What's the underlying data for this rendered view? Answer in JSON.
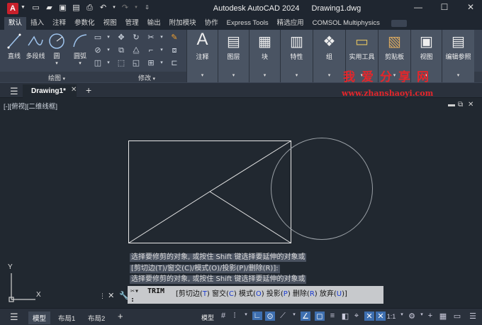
{
  "window": {
    "app_letter": "A",
    "title_app": "Autodesk AutoCAD 2024",
    "title_file": "Drawing1.dwg",
    "minimize": "—",
    "maximize": "☐",
    "close": "✕"
  },
  "ribbon_tabs": [
    "默认",
    "插入",
    "注释",
    "参数化",
    "视图",
    "管理",
    "输出",
    "附加模块",
    "协作",
    "Express Tools",
    "精选应用",
    "COMSOL Multiphysics"
  ],
  "draw_panel": {
    "tools": [
      "直线",
      "多段线",
      "圆",
      "圆弧"
    ],
    "title": "绘图"
  },
  "modify_panel": {
    "title": "修改"
  },
  "big_panels": [
    {
      "label": "注释",
      "glyph": "A"
    },
    {
      "label": "图层",
      "glyph": "▤"
    },
    {
      "label": "块",
      "glyph": "▦"
    },
    {
      "label": "特性",
      "glyph": "▥"
    },
    {
      "label": "组",
      "glyph": "❖"
    },
    {
      "label": "实用工具",
      "glyph": "▭"
    },
    {
      "label": "剪贴板",
      "glyph": "▧"
    },
    {
      "label": "视图",
      "glyph": "▣"
    },
    {
      "label": "编辑参照",
      "glyph": "▤"
    }
  ],
  "file_tab": {
    "name": "Drawing1*",
    "close": "✕",
    "new": "+"
  },
  "watermark": {
    "cn": "我爱分享网",
    "url": "www.zhanshaoyi.com"
  },
  "viewport": {
    "label": "[-][俯视][二维线框]"
  },
  "command": {
    "history": [
      "选择要修剪的对象, 或按住 Shift 键选择要延伸的对象或",
      "[剪切边(T)/窗交(C)/模式(O)/投影(P)/删除(R)]:",
      "选择要修剪的对象, 或按住 Shift 键选择要延伸的对象或"
    ],
    "current_cmd": "TRIM",
    "options_prefix": "[剪切边(",
    "options": [
      {
        "text": "剪切边(",
        "key": "T",
        "end": ")"
      },
      {
        "text": "窗交(",
        "key": "C",
        "end": ")"
      },
      {
        "text": "模式(",
        "key": "O",
        "end": ")"
      },
      {
        "text": "投影(",
        "key": "P",
        "end": ")"
      },
      {
        "text": "删除(",
        "key": "R",
        "end": ")"
      },
      {
        "text": "放弃(",
        "key": "U",
        "end": ")"
      }
    ],
    "prompt_colon": ":"
  },
  "ucs": {
    "x": "X",
    "y": "Y"
  },
  "status": {
    "tabs": [
      "模型",
      "布局1",
      "布局2"
    ],
    "add": "+",
    "model_label": "模型",
    "scale": "1:1"
  }
}
